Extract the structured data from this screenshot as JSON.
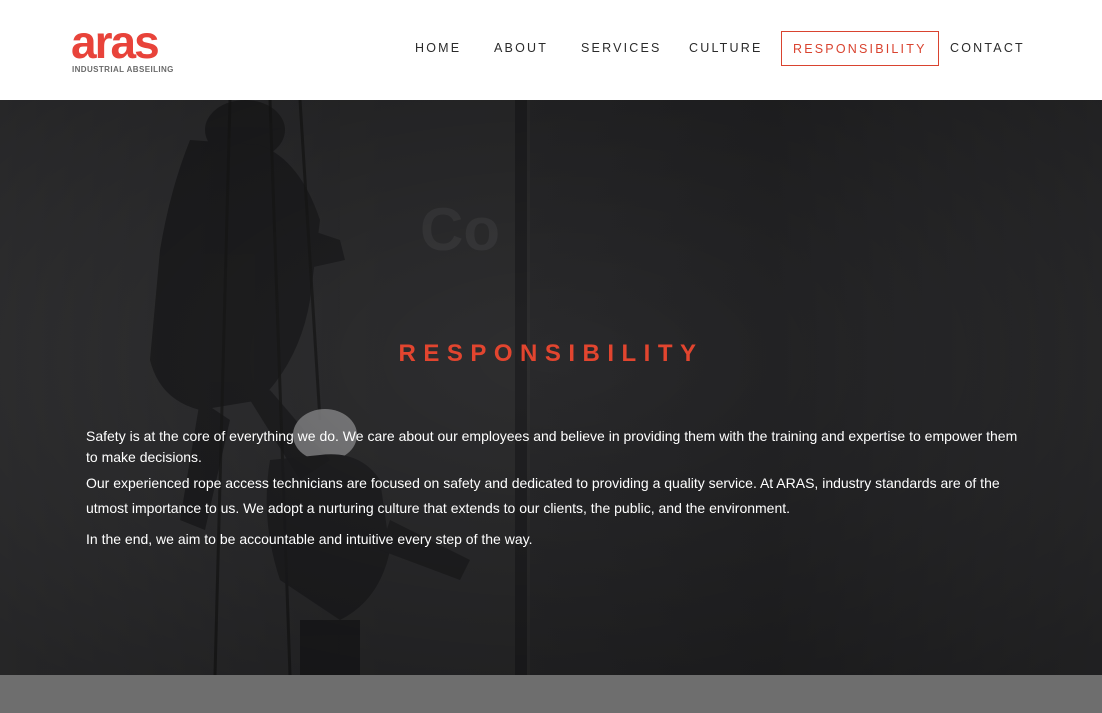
{
  "brand": {
    "wordmark": "aras",
    "tagline": "INDUSTRIAL ABSEILING",
    "color": "#e8433a"
  },
  "nav": {
    "items": [
      {
        "label": "HOME"
      },
      {
        "label": "ABOUT"
      },
      {
        "label": "SERVICES"
      },
      {
        "label": "CULTURE"
      },
      {
        "label": "RESPONSIBILITY",
        "active": true
      },
      {
        "label": "CONTACT"
      }
    ],
    "active_color": "#d9432f"
  },
  "hero": {
    "title": "RESPONSIBILITY",
    "paragraph_1": "Safety is at the core of everything we do. We care about our employees and believe in providing them with the training and expertise to empower them to make decisions.",
    "paragraph_2": "Our experienced rope access technicians are focused on safety and dedicated to providing a quality service. At ARAS, industry standards are of the utmost importance to us. We adopt a nurturing culture that extends to our clients, the public, and the environment.",
    "paragraph_3": "In the end, we aim to be accountable and intuitive every step of the way.",
    "title_color": "#e2452f"
  }
}
